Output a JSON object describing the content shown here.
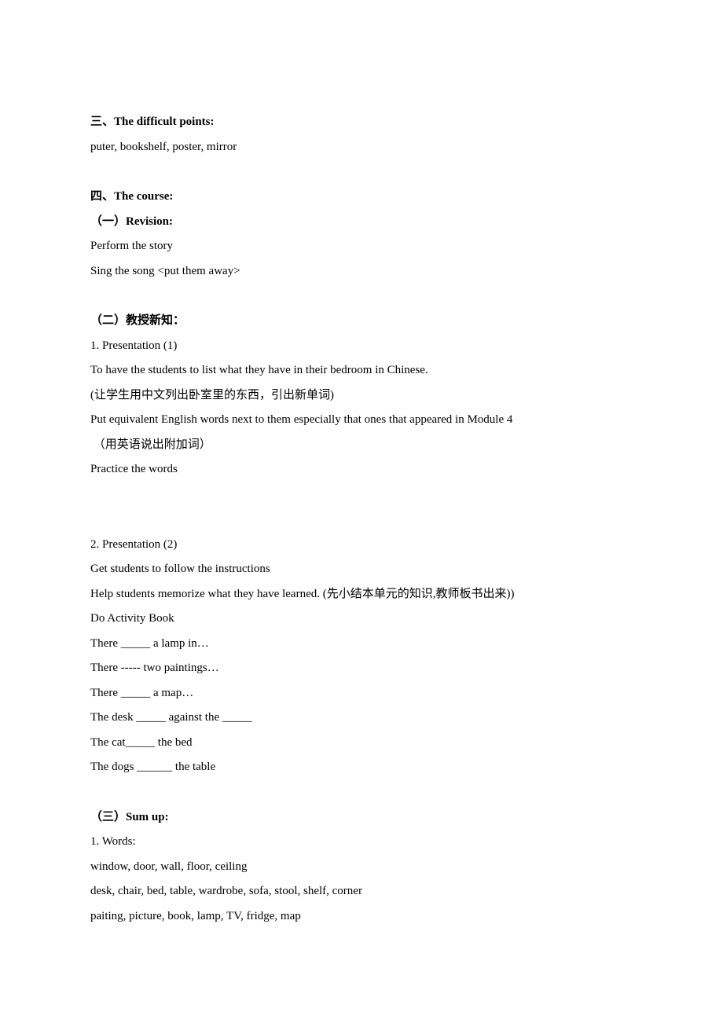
{
  "section3": {
    "heading": "三、The difficult points:",
    "line1": "puter, bookshelf, poster, mirror"
  },
  "section4": {
    "heading": "四、The course:",
    "sub1": {
      "heading": "（一）Revision:",
      "line1": "Perform the story",
      "line2": "Sing the song <put them away>"
    },
    "sub2": {
      "heading": "（二）教授新知：",
      "p1": {
        "line1": "1. Presentation (1)",
        "line2": "To have the students to list what they have in their bedroom in Chinese.",
        "line3": "(让学生用中文列出卧室里的东西，引出新单词)",
        "line4": "Put equivalent English words next to them especially that ones that appeared in Module 4",
        "line5": " （用英语说出附加词）",
        "line6": "Practice the words"
      },
      "p2": {
        "line1": "2. Presentation (2)",
        "line2": "Get students to follow the instructions",
        "line3": "Help students memorize what they have learned. (先小结本单元的知识,教师板书出来))",
        "line4": "Do Activity Book",
        "line5": "There _____ a lamp in…",
        "line6": "There ----- two paintings…",
        "line7": "There _____ a map…",
        "line8": "The desk _____ against the _____",
        "line9": "The cat_____ the bed",
        "line10": "The dogs ______ the table"
      }
    },
    "sub3": {
      "heading": "（三）Sum up:",
      "line1": "1. Words:",
      "line2": "window, door, wall, floor, ceiling",
      "line3": "desk, chair, bed, table, wardrobe, sofa, stool, shelf, corner",
      "line4": "paiting, picture, book, lamp, TV, fridge, map"
    }
  }
}
